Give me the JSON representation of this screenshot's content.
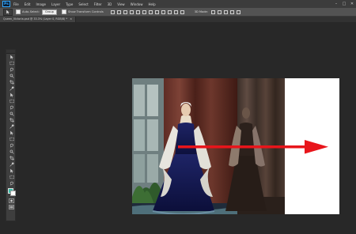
{
  "app": {
    "logo_text": "Ps"
  },
  "menu": [
    "File",
    "Edit",
    "Image",
    "Layer",
    "Type",
    "Select",
    "Filter",
    "3D",
    "View",
    "Window",
    "Help"
  ],
  "window_controls": {
    "minimize": "–",
    "maximize": "□",
    "close": "✕"
  },
  "options_bar": {
    "tool_icon": "move-tool-icon",
    "auto_select_label": "Auto-Select:",
    "auto_select_value": "Group",
    "show_transform_label": "Show Transform Controls",
    "mode_3d_label": "3D Mode:"
  },
  "document_tab": {
    "label": "Queen_Victoria.psd @ 33.3% (Layer 0, RGB/8) *",
    "close": "×"
  },
  "tools": [
    "move-tool",
    "marquee-tool",
    "lasso-tool",
    "quick-selection-tool",
    "crop-tool",
    "eyedropper-tool",
    "spot-healing-tool",
    "brush-tool",
    "clone-stamp-tool",
    "history-brush-tool",
    "eraser-tool",
    "gradient-tool",
    "blur-tool",
    "dodge-tool",
    "pen-tool",
    "type-tool",
    "path-selection-tool",
    "rectangle-tool",
    "hand-tool",
    "zoom-tool",
    "edit-toolbar"
  ],
  "colors": {
    "foreground": "#3bbba8",
    "background": "#ffffff",
    "arrow": "#e8151b",
    "ps_blue": "#31a8ff"
  }
}
